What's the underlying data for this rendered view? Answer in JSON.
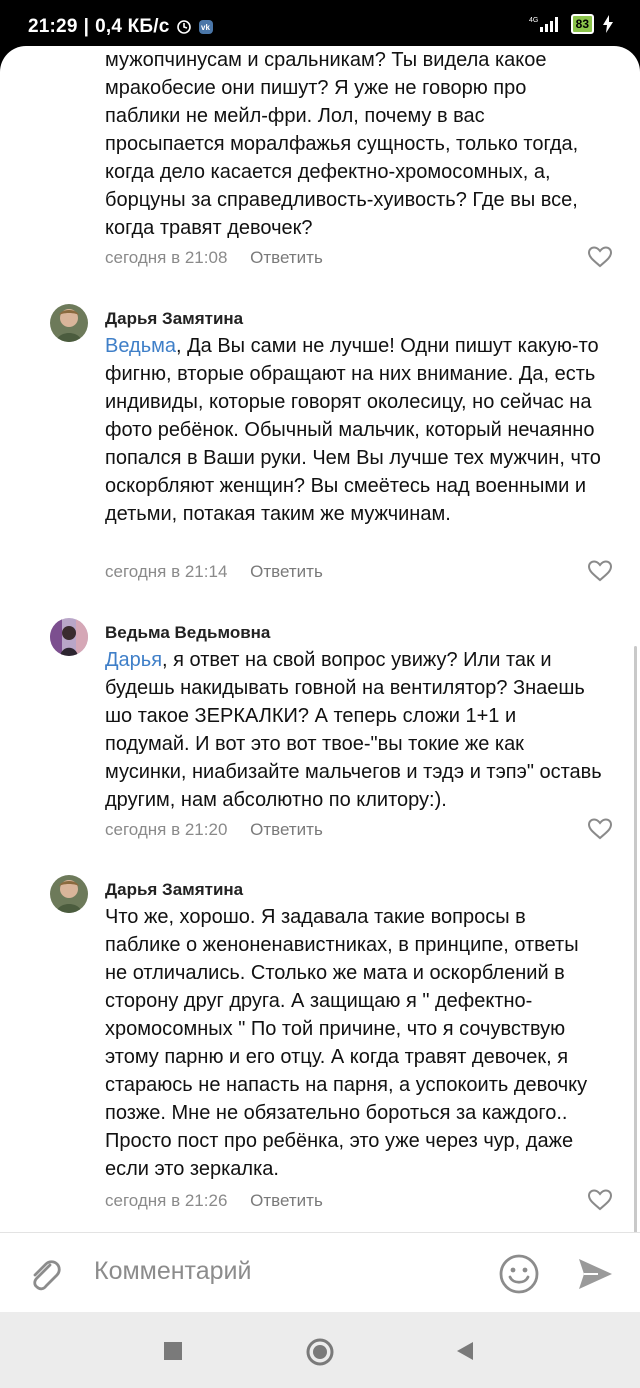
{
  "status": {
    "time": "21:29",
    "speed": "0,4 КБ/с",
    "network": "4G",
    "battery": "83"
  },
  "comments": [
    {
      "author": "",
      "mention": "",
      "text": "мужопчинусам и сральникам? Ты видела какое мракобесие они пишут? Я уже не говорю про паблики не мейл-фри. Лол, почему в вас просыпается моралфажья сущность, только тогда, когда дело касается дефектно-хромосомных, а, борцуны за справедливость-хуивость? Где вы все, когда травят девочек?",
      "time": "сегодня в 21:08",
      "reply": "Ответить"
    },
    {
      "author": "Дарья Замятина",
      "mention": "Ведьма",
      "text": ", Да Вы сами не лучше! Одни пишут какую-то фигню, вторые обращают на них внимание. Да, есть индивиды, которые говорят околесицу, но сейчас на фото ребёнок. Обычный мальчик, который нечаянно попался в Ваши руки. Чем Вы лучше тех мужчин, что оскорбляют женщин? Вы смеётесь над военными и детьми, потакая таким же мужчинам.",
      "time": "сегодня в 21:14",
      "reply": "Ответить"
    },
    {
      "author": "Ведьма Ведьмовна",
      "mention": "Дарья",
      "text": ", я ответ на свой вопрос увижу? Или так и будешь накидывать говной на вентилятор? Знаешь шо такое ЗЕРКАЛКИ? А теперь сложи 1+1 и подумай. И вот это вот твое-\"вы токие же как мусинки, ниабизайте мальчегов и тэдэ и тэпэ\" оставь другим, нам абсолютно по клитору:).",
      "time": "сегодня в 21:20",
      "reply": "Ответить"
    },
    {
      "author": "Дарья Замятина",
      "mention": "",
      "text": "Что же, хорошо. Я задавала такие вопросы в паблике о женоненавистниках, в принципе, ответы не отличались. Столько же мата и оскорблений в сторону друг друга. А защищаю я \" дефектно-хромосомных \" По той причине, что я сочувствую этому парню и его отцу. А когда травят девочек, я стараюсь не напасть на парня, а успокоить девочку позже. Мне не обязательно бороться за каждого.. Просто пост про ребёнка, это уже через чур, даже если это зеркалка.",
      "time": "сегодня в 21:26",
      "reply": "Ответить"
    }
  ],
  "input": {
    "placeholder": "Комментарий"
  },
  "icons": {
    "attach": "paperclip-icon",
    "emoji": "smile-icon",
    "send": "send-icon",
    "like": "heart-outline-icon",
    "nav": [
      "square-icon",
      "circle-icon",
      "back-triangle-icon"
    ]
  },
  "colors": {
    "mention": "#3f7fc8",
    "meta": "#8a8a8a",
    "battery": "#8bc34a"
  }
}
